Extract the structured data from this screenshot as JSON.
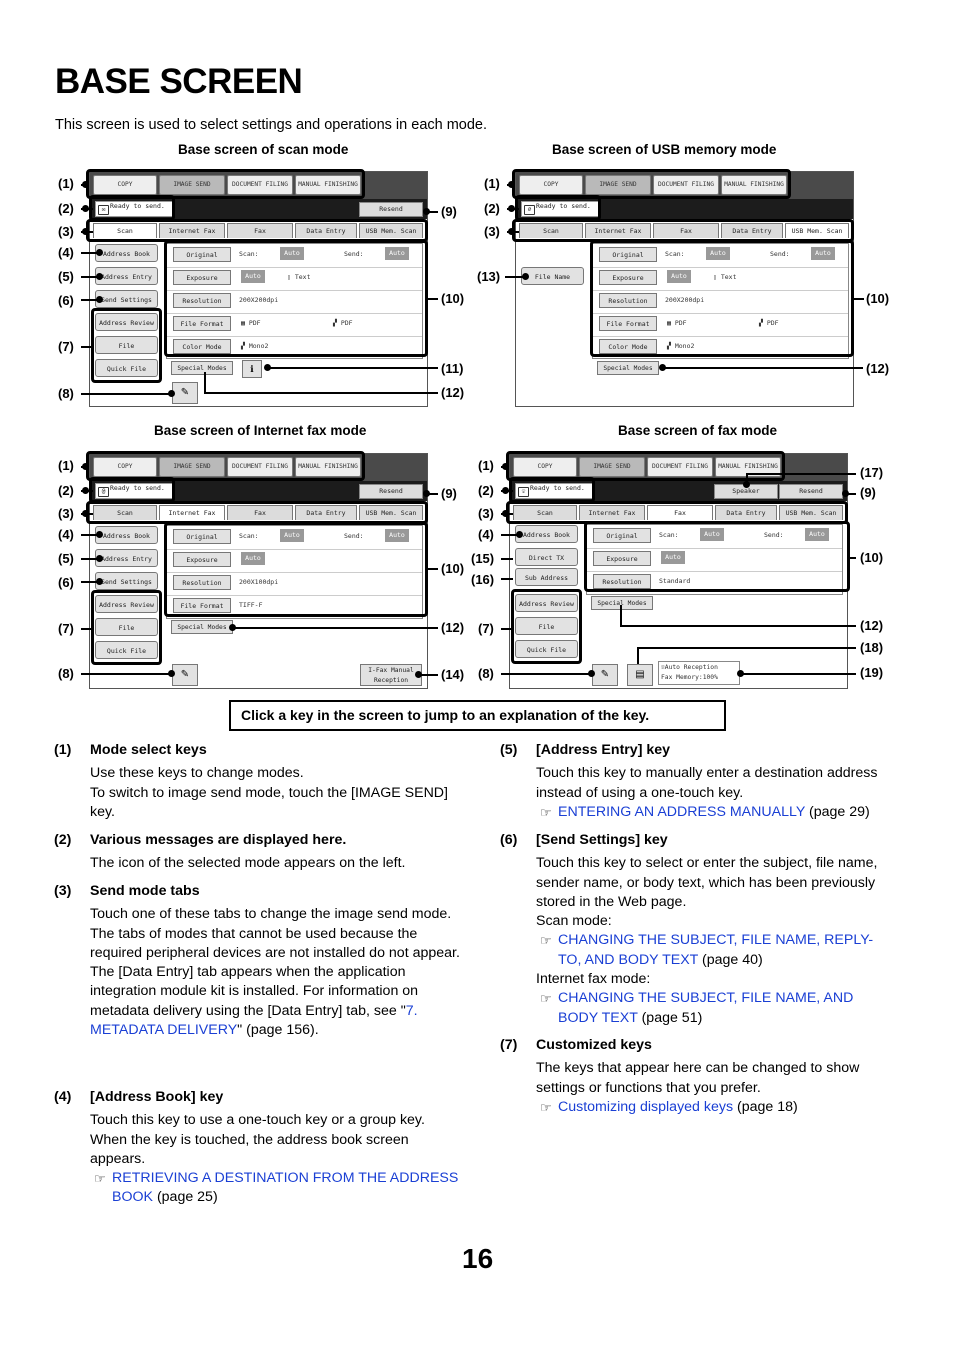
{
  "page": {
    "title": "BASE SCREEN",
    "intro": "This screen is used to select settings and operations in each mode.",
    "page_number": "16",
    "note": "Click a key in the screen to jump to an explanation of the key."
  },
  "screens": {
    "scan": {
      "heading": "Base screen of scan mode",
      "mode_keys": [
        "COPY",
        "IMAGE SEND",
        "DOCUMENT FILING",
        "MANUAL FINISHING"
      ],
      "message": "Ready to send.",
      "resend": "Resend",
      "tabs": [
        "Scan",
        "Internet Fax",
        "Fax",
        "Data Entry",
        "USB Mem. Scan"
      ],
      "left_keys": [
        "Address Book",
        "Address Entry",
        "Send Settings",
        "Address Review",
        "File",
        "Quick File"
      ],
      "rows": {
        "original": "Original",
        "scan": "Scan:",
        "send": "Send:",
        "auto": "Auto",
        "exposure": "Exposure",
        "text": "Text",
        "resolution": "Resolution",
        "res_val": "200X200dpi",
        "file_format": "File Format",
        "pdf": "PDF",
        "color_mode": "Color Mode",
        "mono": "Mono2"
      },
      "special_modes": "Special Modes",
      "callouts_left": [
        "(1)",
        "(2)",
        "(3)",
        "(4)",
        "(5)",
        "(6)",
        "(7)",
        "(8)"
      ],
      "callouts_right": [
        "(9)",
        "(10)",
        "(11)",
        "(12)"
      ]
    },
    "usb": {
      "heading": "Base screen of USB memory mode",
      "file_name": "File Name",
      "callouts_left": [
        "(1)",
        "(2)",
        "(3)",
        "(13)"
      ],
      "callouts_right": [
        "(10)",
        "(12)"
      ]
    },
    "ifax": {
      "heading": "Base screen of Internet fax mode",
      "res_val": "200X100dpi",
      "format_val": "TIFF-F",
      "manual_reception": "I-Fax Manual Reception",
      "callouts_left": [
        "(1)",
        "(2)",
        "(3)",
        "(4)",
        "(5)",
        "(6)",
        "(7)",
        "(8)"
      ],
      "callouts_right": [
        "(9)",
        "(10)",
        "(12)",
        "(14)"
      ]
    },
    "fax": {
      "heading": "Base screen of fax mode",
      "speaker": "Speaker",
      "direct_tx": "Direct TX",
      "sub_address": "Sub Address",
      "res_val": "Standard",
      "auto_reception": "Auto Reception",
      "fax_memory": "Fax Memory:100%",
      "callouts_left": [
        "(1)",
        "(2)",
        "(3)",
        "(4)",
        "(15)",
        "(16)",
        "(7)",
        "(8)"
      ],
      "callouts_right": [
        "(17)",
        "(9)",
        "(10)",
        "(12)",
        "(18)",
        "(19)"
      ]
    }
  },
  "sections": {
    "s1": {
      "num": "(1)",
      "title": "Mode select keys",
      "body": [
        "Use these keys to change modes.",
        "To switch to image send mode, touch the [IMAGE SEND] key."
      ]
    },
    "s2": {
      "num": "(2)",
      "title": "Various messages are displayed here.",
      "body": [
        "The icon of the selected mode appears on the left."
      ]
    },
    "s3": {
      "num": "(3)",
      "title": "Send mode tabs",
      "body": [
        "Touch one of these tabs to change the image send mode.",
        "The tabs of modes that cannot be used because the required peripheral devices are not installed do not appear.",
        "The [Data Entry] tab appears when the application integration module kit is installed. For information on metadata delivery using the [Data Entry] tab, see \""
      ],
      "link_a": "7. METADATA DELIVERY",
      "tail": "\" (page 156)."
    },
    "s4": {
      "num": "(4)",
      "title": "[Address Book] key",
      "body": "Touch this key to use a one-touch key or a group key. When the key is touched, the address book screen appears.",
      "link": "RETRIEVING A DESTINATION FROM THE ADDRESS BOOK",
      "page": " (page 25)"
    },
    "s5": {
      "num": "(5)",
      "title": "[Address Entry] key",
      "body": "Touch this key to manually enter a destination address instead of using a one-touch key.",
      "link": "ENTERING AN ADDRESS MANUALLY",
      "page": " (page 29)"
    },
    "s6": {
      "num": "(6)",
      "title": "[Send Settings] key",
      "body": "Touch this key to select or enter the subject, file name, sender name, or body text, which has been previously stored in the Web page.",
      "scan_label": "Scan mode:",
      "link1": "CHANGING THE SUBJECT, FILE NAME, REPLY-TO, AND BODY TEXT",
      "page1": " (page 40)",
      "ifax_label": "Internet fax mode:",
      "link2": "CHANGING THE SUBJECT, FILE NAME, AND BODY TEXT",
      "page2": " (page 51)"
    },
    "s7": {
      "num": "(7)",
      "title": "Customized keys",
      "body": "The keys that appear here can be changed to show settings or functions that you prefer.",
      "link": "Customizing displayed keys",
      "page": " (page 18)"
    }
  }
}
